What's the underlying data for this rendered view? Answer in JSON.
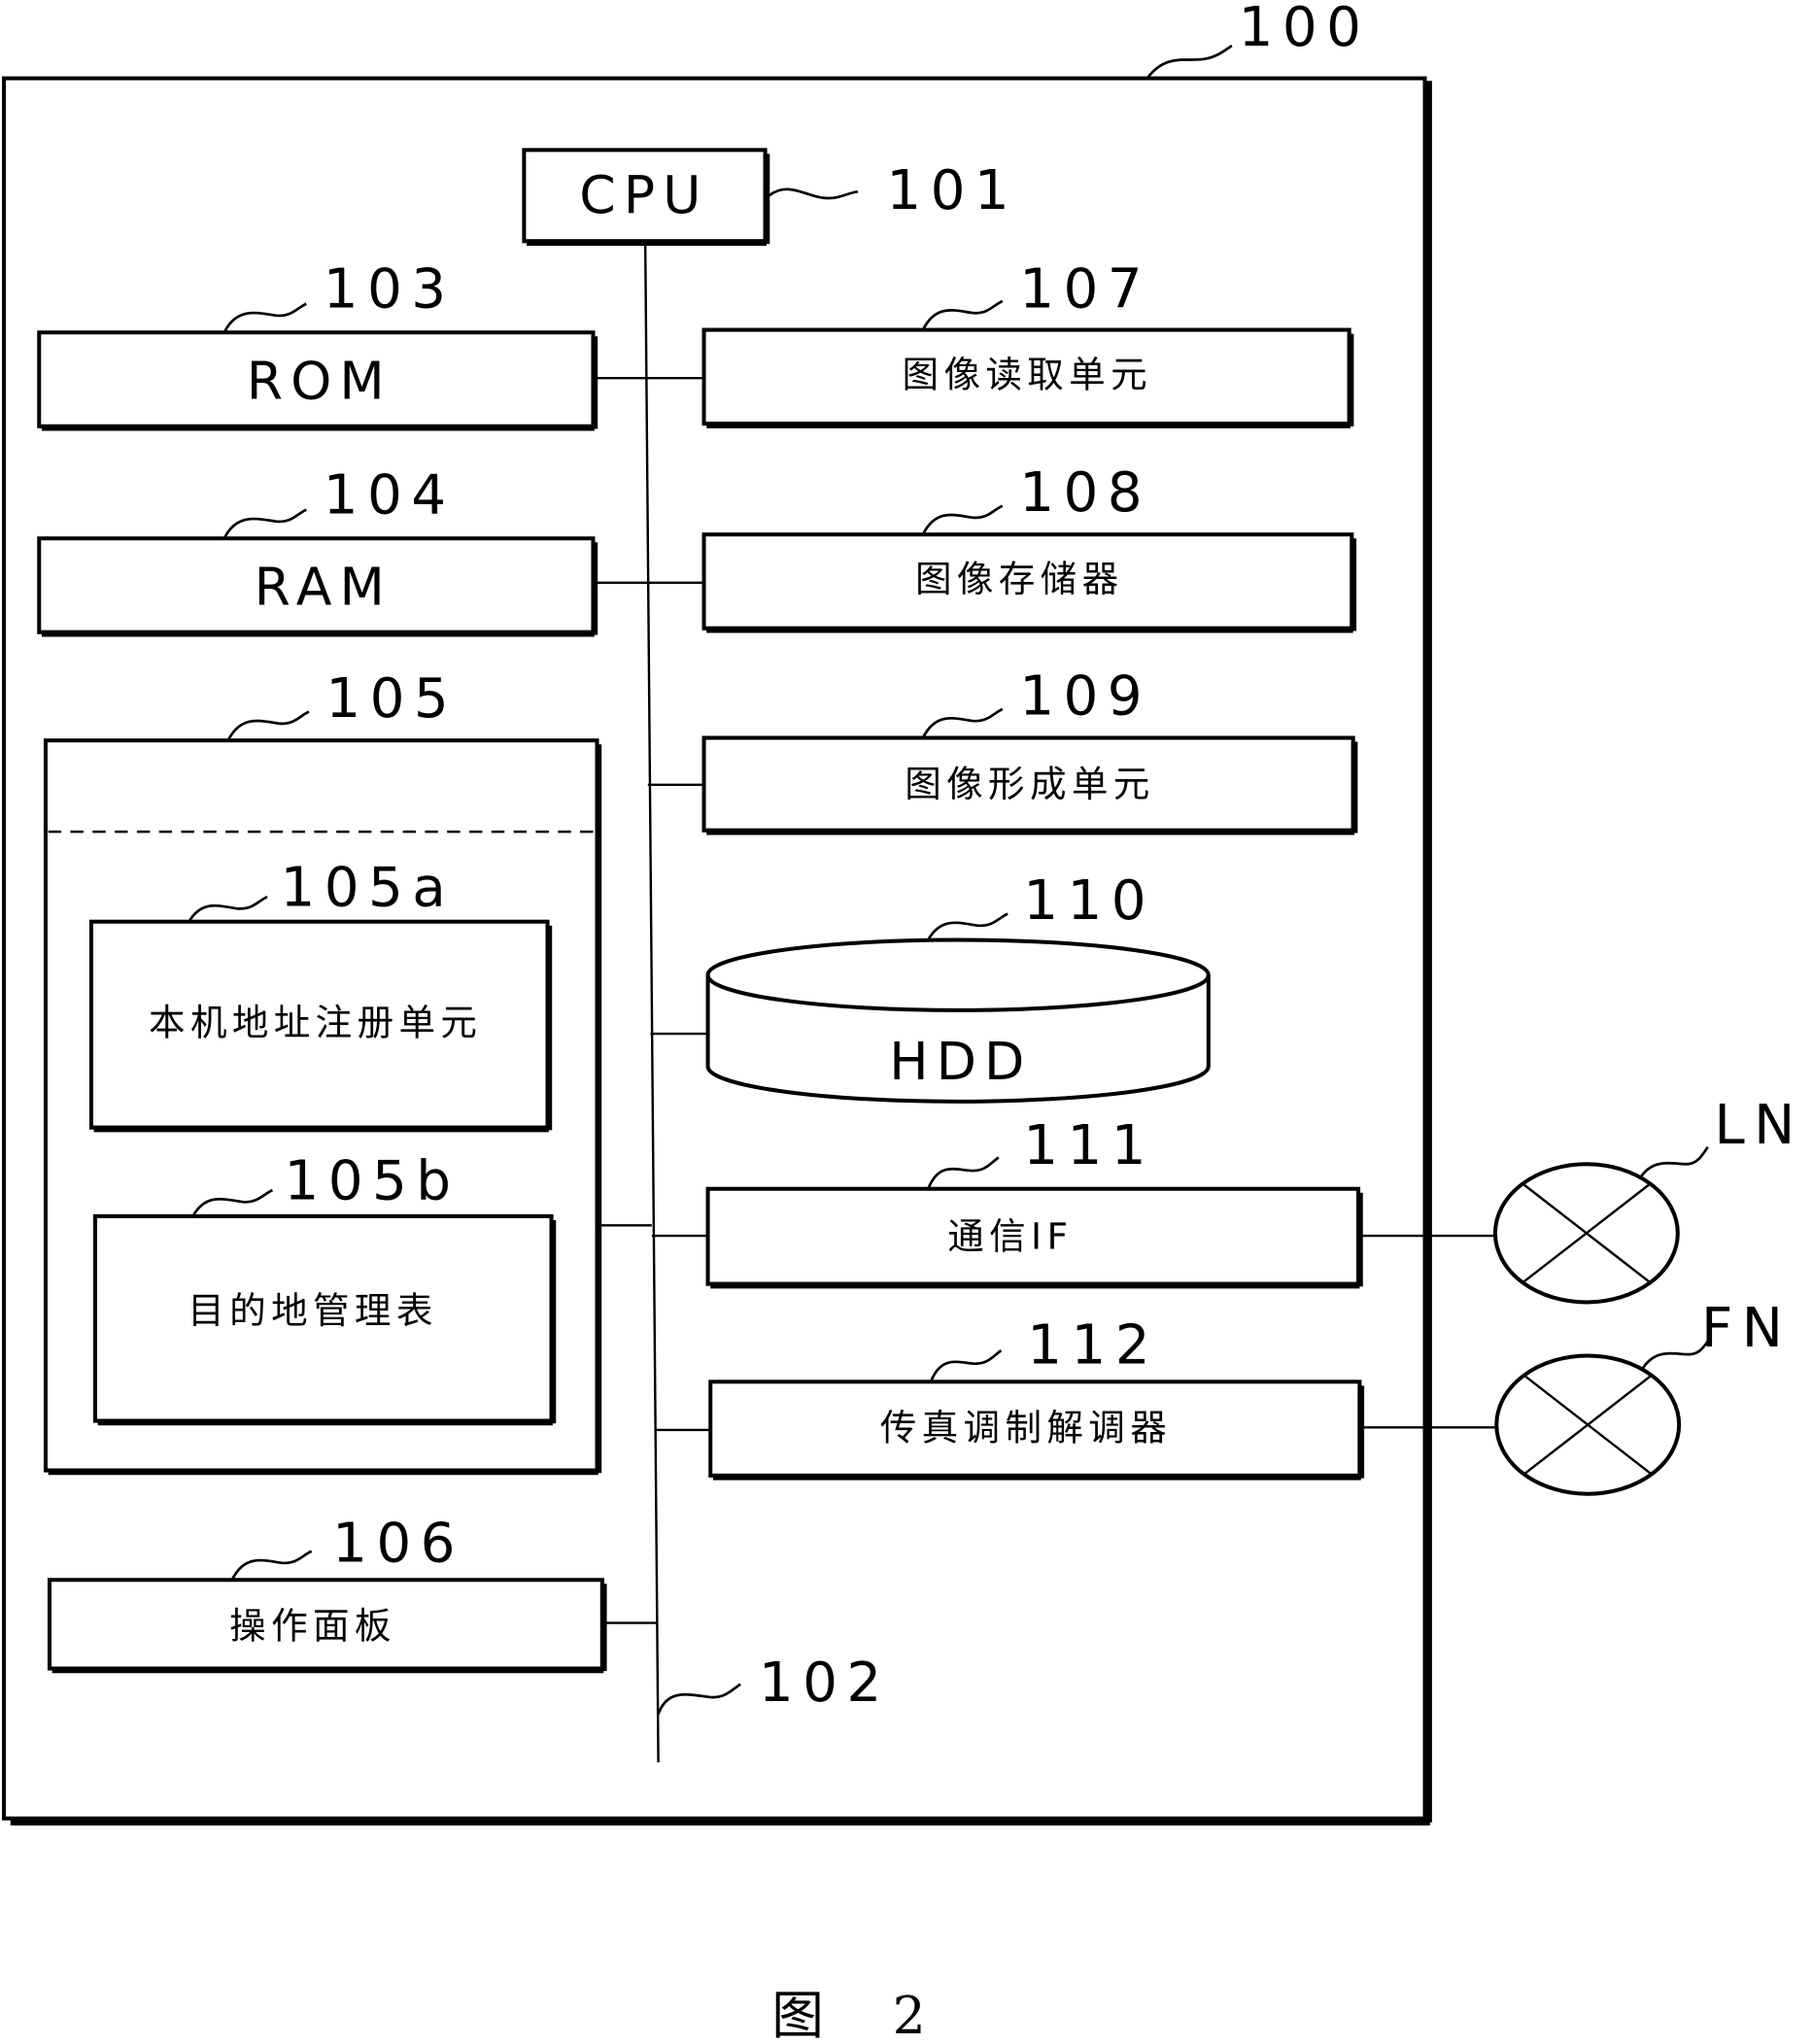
{
  "figure": {
    "caption": "图 2",
    "device_ref": "100",
    "bus_ref": "102"
  },
  "blocks": {
    "cpu": {
      "ref": "101",
      "label": "CPU"
    },
    "rom": {
      "ref": "103",
      "label": "ROM"
    },
    "ram": {
      "ref": "104",
      "label": "RAM"
    },
    "storage": {
      "ref": "105",
      "label": ""
    },
    "own_address_registration": {
      "ref": "105a",
      "label": "本机地址注册单元"
    },
    "destination_table": {
      "ref": "105b",
      "label": "目的地管理表"
    },
    "operation_panel": {
      "ref": "106",
      "label": "操作面板"
    },
    "image_reading_unit": {
      "ref": "107",
      "label": "图像读取单元"
    },
    "image_memory": {
      "ref": "108",
      "label": "图像存储器"
    },
    "image_forming_unit": {
      "ref": "109",
      "label": "图像形成单元"
    },
    "hdd": {
      "ref": "110",
      "label": "HDD"
    },
    "comm_if": {
      "ref": "111",
      "label": "通信IF"
    },
    "fax_modem": {
      "ref": "112",
      "label": "传真调制解调器"
    }
  },
  "networks": {
    "lan": {
      "label": "LN"
    },
    "fax": {
      "label": "FN"
    }
  }
}
